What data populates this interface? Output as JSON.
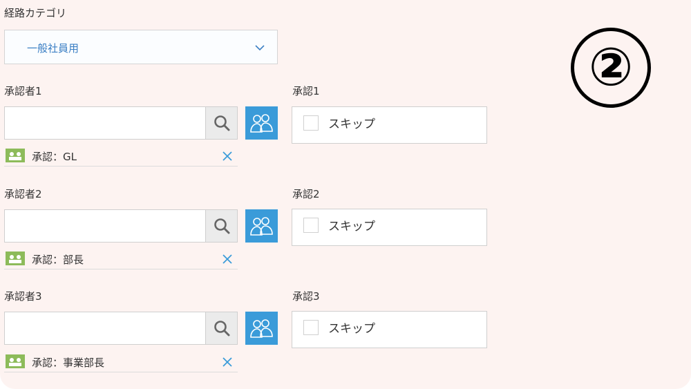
{
  "route_category": {
    "label": "経路カテゴリ",
    "selected": "一般社員用"
  },
  "badge": "②",
  "approvers": [
    {
      "label": "承認者1",
      "input_value": "",
      "chip": "承認：GL",
      "skip_label": "承認1",
      "skip_text": "スキップ"
    },
    {
      "label": "承認者2",
      "input_value": "",
      "chip": "承認：部長",
      "skip_label": "承認2",
      "skip_text": "スキップ"
    },
    {
      "label": "承認者3",
      "input_value": "",
      "chip": "承認：事業部長",
      "skip_label": "承認3",
      "skip_text": "スキップ"
    }
  ],
  "icons": {
    "search": "search-icon",
    "org": "organization-icon",
    "remove": "close-icon",
    "chevron": "chevron-down-icon",
    "avatar": "group-avatar-icon"
  },
  "colors": {
    "accent": "#3a9bd9",
    "link": "#3b7fc4",
    "background": "#fdf3f1",
    "avatar": "#8dbb5a"
  }
}
